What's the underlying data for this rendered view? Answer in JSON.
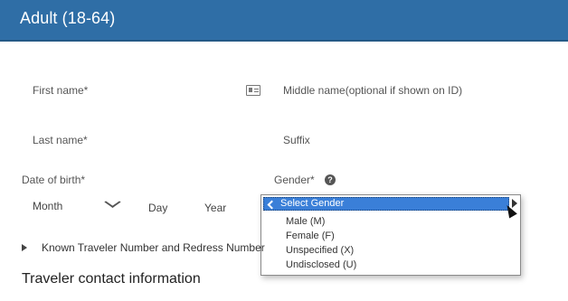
{
  "header": {
    "title": "Adult (18-64)"
  },
  "form": {
    "first_name_label": "First name*",
    "middle_name_label": "Middle name(optional if shown on ID)",
    "last_name_label": "Last name*",
    "suffix_label": "Suffix",
    "dob_label": "Date of birth*",
    "dob": {
      "month": "Month",
      "day": "Day",
      "year": "Year"
    },
    "gender_label": "Gender*",
    "gender_options": [
      "Select Gender",
      "Male (M)",
      "Female (F)",
      "Unspecified (X)",
      "Undisclosed (U)"
    ],
    "ktn_link": "Known Traveler Number and Redress Number"
  },
  "contact": {
    "heading": "Traveler contact information"
  },
  "colors": {
    "header": "#2f6ea6",
    "selection": "#3a7fd8"
  },
  "icons": [
    "id-card-icon",
    "help-icon",
    "chevron-down-icon",
    "check-icon",
    "expand-icon",
    "cursor-icon",
    "scroll-arrow-icon"
  ]
}
